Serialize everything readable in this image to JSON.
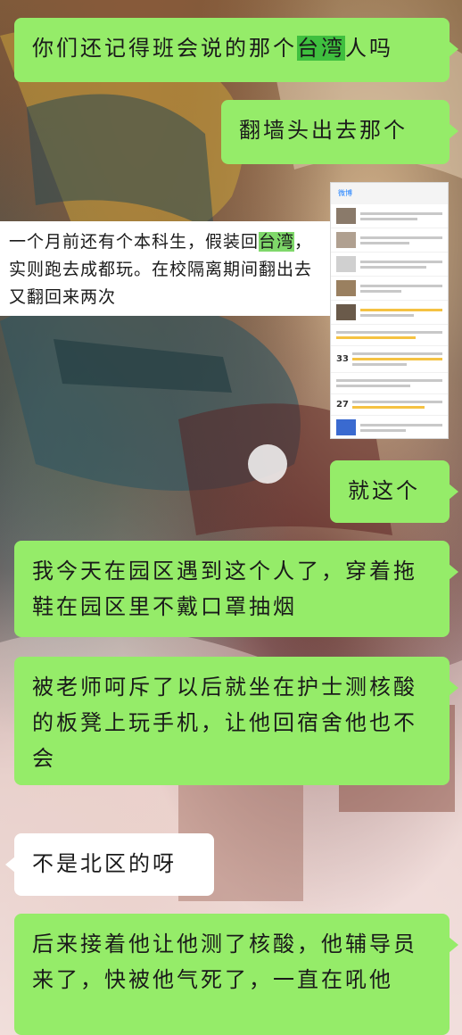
{
  "messages": [
    {
      "segments": [
        {
          "text": "你们还记得班会说的那个"
        },
        {
          "text": "台湾",
          "highlight": true
        },
        {
          "text": "人吗"
        }
      ]
    },
    {
      "text": "翻墙头出去那个"
    },
    {
      "text": "就这个"
    },
    {
      "text": "我今天在园区遇到这个人了，穿着拖鞋在园区里不戴口罩抽烟"
    },
    {
      "text": "被老师呵斥了以后就坐在护士测核酸的板凳上玩手机，让他回宿舍他也不会"
    },
    {
      "text": "不是北区的呀"
    },
    {
      "text": "后来接着他让他测了核酸，他辅导员来了，快被他气死了，一直在吼他"
    }
  ],
  "caption": {
    "segments": [
      {
        "text": "一个月前还有个本科生，假装回"
      },
      {
        "text": "台湾",
        "highlight": true
      },
      {
        "text": "，实则跑去成都玩。在校隔离期间翻出去又翻回来两次"
      }
    ]
  },
  "screenshot": {
    "header": "微博",
    "row_numbers": [
      "33",
      "27"
    ]
  },
  "colors": {
    "bubble_sent": "#95ec69",
    "bubble_received": "#ffffff",
    "highlight": "#3fbf3f"
  }
}
